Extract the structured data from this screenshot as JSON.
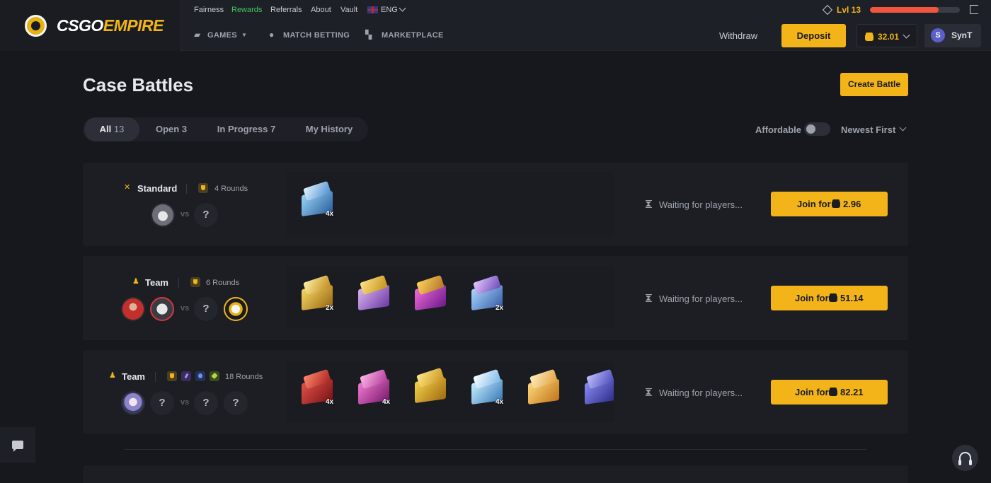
{
  "brand": {
    "logo_main": "CSGO",
    "logo_accent": "EMPIRE"
  },
  "topbar": {
    "links": [
      "Fairness",
      "Rewards",
      "Referrals",
      "About",
      "Vault"
    ],
    "language": "ENG",
    "level": "Lvl 13",
    "xp_progress": 0.76
  },
  "nav": {
    "games": "GAMES",
    "match_betting": "MATCH BETTING",
    "marketplace": "MARKETPLACE"
  },
  "account": {
    "withdraw": "Withdraw",
    "deposit": "Deposit",
    "balance": "32.01",
    "avatar_letter": "S",
    "username": "SynT"
  },
  "page": {
    "title": "Case Battles",
    "create_button": "Create Battle"
  },
  "tabs": [
    {
      "label": "All",
      "count": "13"
    },
    {
      "label": "Open",
      "count": "3"
    },
    {
      "label": "In Progress",
      "count": "7"
    },
    {
      "label": "My History",
      "count": ""
    }
  ],
  "filters": {
    "affordable": "Affordable",
    "affordable_on": false,
    "sort": "Newest First"
  },
  "battles": [
    {
      "mode": "Standard",
      "rounds": "4 Rounds",
      "vs": "vs",
      "status": "Waiting for players...",
      "join_label": "Join for",
      "price": "2.96",
      "case_multipliers": [
        "4x"
      ]
    },
    {
      "mode": "Team",
      "rounds": "6 Rounds",
      "vs": "vs",
      "status": "Waiting for players...",
      "join_label": "Join for",
      "price": "51.14",
      "case_multipliers": [
        "2x",
        "",
        "",
        "2x"
      ]
    },
    {
      "mode": "Team",
      "rounds": "18 Rounds",
      "vs": "vs",
      "status": "Waiting for players...",
      "join_label": "Join for",
      "price": "82.21",
      "case_multipliers": [
        "4x",
        "4x",
        "",
        "4x",
        "",
        ""
      ]
    }
  ],
  "slot_placeholder": "?",
  "colors": {
    "accent": "#f2b418",
    "rewards": "#43c45e",
    "xp": "#f0563e",
    "background": "#16181d"
  }
}
